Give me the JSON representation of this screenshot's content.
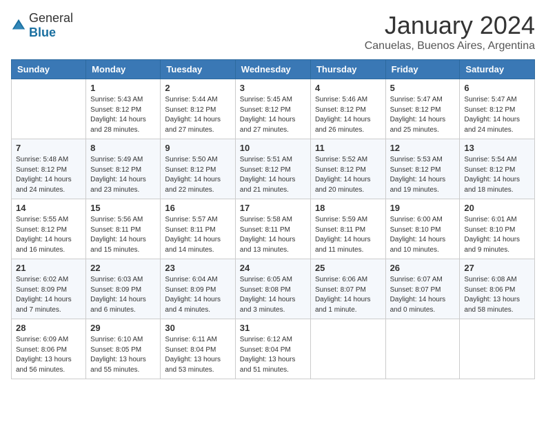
{
  "header": {
    "logo_general": "General",
    "logo_blue": "Blue",
    "month_title": "January 2024",
    "location": "Canuelas, Buenos Aires, Argentina"
  },
  "days_of_week": [
    "Sunday",
    "Monday",
    "Tuesday",
    "Wednesday",
    "Thursday",
    "Friday",
    "Saturday"
  ],
  "weeks": [
    [
      {
        "day": "",
        "sunrise": "",
        "sunset": "",
        "daylight": ""
      },
      {
        "day": "1",
        "sunrise": "Sunrise: 5:43 AM",
        "sunset": "Sunset: 8:12 PM",
        "daylight": "Daylight: 14 hours and 28 minutes."
      },
      {
        "day": "2",
        "sunrise": "Sunrise: 5:44 AM",
        "sunset": "Sunset: 8:12 PM",
        "daylight": "Daylight: 14 hours and 27 minutes."
      },
      {
        "day": "3",
        "sunrise": "Sunrise: 5:45 AM",
        "sunset": "Sunset: 8:12 PM",
        "daylight": "Daylight: 14 hours and 27 minutes."
      },
      {
        "day": "4",
        "sunrise": "Sunrise: 5:46 AM",
        "sunset": "Sunset: 8:12 PM",
        "daylight": "Daylight: 14 hours and 26 minutes."
      },
      {
        "day": "5",
        "sunrise": "Sunrise: 5:47 AM",
        "sunset": "Sunset: 8:12 PM",
        "daylight": "Daylight: 14 hours and 25 minutes."
      },
      {
        "day": "6",
        "sunrise": "Sunrise: 5:47 AM",
        "sunset": "Sunset: 8:12 PM",
        "daylight": "Daylight: 14 hours and 24 minutes."
      }
    ],
    [
      {
        "day": "7",
        "sunrise": "Sunrise: 5:48 AM",
        "sunset": "Sunset: 8:12 PM",
        "daylight": "Daylight: 14 hours and 24 minutes."
      },
      {
        "day": "8",
        "sunrise": "Sunrise: 5:49 AM",
        "sunset": "Sunset: 8:12 PM",
        "daylight": "Daylight: 14 hours and 23 minutes."
      },
      {
        "day": "9",
        "sunrise": "Sunrise: 5:50 AM",
        "sunset": "Sunset: 8:12 PM",
        "daylight": "Daylight: 14 hours and 22 minutes."
      },
      {
        "day": "10",
        "sunrise": "Sunrise: 5:51 AM",
        "sunset": "Sunset: 8:12 PM",
        "daylight": "Daylight: 14 hours and 21 minutes."
      },
      {
        "day": "11",
        "sunrise": "Sunrise: 5:52 AM",
        "sunset": "Sunset: 8:12 PM",
        "daylight": "Daylight: 14 hours and 20 minutes."
      },
      {
        "day": "12",
        "sunrise": "Sunrise: 5:53 AM",
        "sunset": "Sunset: 8:12 PM",
        "daylight": "Daylight: 14 hours and 19 minutes."
      },
      {
        "day": "13",
        "sunrise": "Sunrise: 5:54 AM",
        "sunset": "Sunset: 8:12 PM",
        "daylight": "Daylight: 14 hours and 18 minutes."
      }
    ],
    [
      {
        "day": "14",
        "sunrise": "Sunrise: 5:55 AM",
        "sunset": "Sunset: 8:12 PM",
        "daylight": "Daylight: 14 hours and 16 minutes."
      },
      {
        "day": "15",
        "sunrise": "Sunrise: 5:56 AM",
        "sunset": "Sunset: 8:11 PM",
        "daylight": "Daylight: 14 hours and 15 minutes."
      },
      {
        "day": "16",
        "sunrise": "Sunrise: 5:57 AM",
        "sunset": "Sunset: 8:11 PM",
        "daylight": "Daylight: 14 hours and 14 minutes."
      },
      {
        "day": "17",
        "sunrise": "Sunrise: 5:58 AM",
        "sunset": "Sunset: 8:11 PM",
        "daylight": "Daylight: 14 hours and 13 minutes."
      },
      {
        "day": "18",
        "sunrise": "Sunrise: 5:59 AM",
        "sunset": "Sunset: 8:11 PM",
        "daylight": "Daylight: 14 hours and 11 minutes."
      },
      {
        "day": "19",
        "sunrise": "Sunrise: 6:00 AM",
        "sunset": "Sunset: 8:10 PM",
        "daylight": "Daylight: 14 hours and 10 minutes."
      },
      {
        "day": "20",
        "sunrise": "Sunrise: 6:01 AM",
        "sunset": "Sunset: 8:10 PM",
        "daylight": "Daylight: 14 hours and 9 minutes."
      }
    ],
    [
      {
        "day": "21",
        "sunrise": "Sunrise: 6:02 AM",
        "sunset": "Sunset: 8:09 PM",
        "daylight": "Daylight: 14 hours and 7 minutes."
      },
      {
        "day": "22",
        "sunrise": "Sunrise: 6:03 AM",
        "sunset": "Sunset: 8:09 PM",
        "daylight": "Daylight: 14 hours and 6 minutes."
      },
      {
        "day": "23",
        "sunrise": "Sunrise: 6:04 AM",
        "sunset": "Sunset: 8:09 PM",
        "daylight": "Daylight: 14 hours and 4 minutes."
      },
      {
        "day": "24",
        "sunrise": "Sunrise: 6:05 AM",
        "sunset": "Sunset: 8:08 PM",
        "daylight": "Daylight: 14 hours and 3 minutes."
      },
      {
        "day": "25",
        "sunrise": "Sunrise: 6:06 AM",
        "sunset": "Sunset: 8:07 PM",
        "daylight": "Daylight: 14 hours and 1 minute."
      },
      {
        "day": "26",
        "sunrise": "Sunrise: 6:07 AM",
        "sunset": "Sunset: 8:07 PM",
        "daylight": "Daylight: 14 hours and 0 minutes."
      },
      {
        "day": "27",
        "sunrise": "Sunrise: 6:08 AM",
        "sunset": "Sunset: 8:06 PM",
        "daylight": "Daylight: 13 hours and 58 minutes."
      }
    ],
    [
      {
        "day": "28",
        "sunrise": "Sunrise: 6:09 AM",
        "sunset": "Sunset: 8:06 PM",
        "daylight": "Daylight: 13 hours and 56 minutes."
      },
      {
        "day": "29",
        "sunrise": "Sunrise: 6:10 AM",
        "sunset": "Sunset: 8:05 PM",
        "daylight": "Daylight: 13 hours and 55 minutes."
      },
      {
        "day": "30",
        "sunrise": "Sunrise: 6:11 AM",
        "sunset": "Sunset: 8:04 PM",
        "daylight": "Daylight: 13 hours and 53 minutes."
      },
      {
        "day": "31",
        "sunrise": "Sunrise: 6:12 AM",
        "sunset": "Sunset: 8:04 PM",
        "daylight": "Daylight: 13 hours and 51 minutes."
      },
      {
        "day": "",
        "sunrise": "",
        "sunset": "",
        "daylight": ""
      },
      {
        "day": "",
        "sunrise": "",
        "sunset": "",
        "daylight": ""
      },
      {
        "day": "",
        "sunrise": "",
        "sunset": "",
        "daylight": ""
      }
    ]
  ]
}
